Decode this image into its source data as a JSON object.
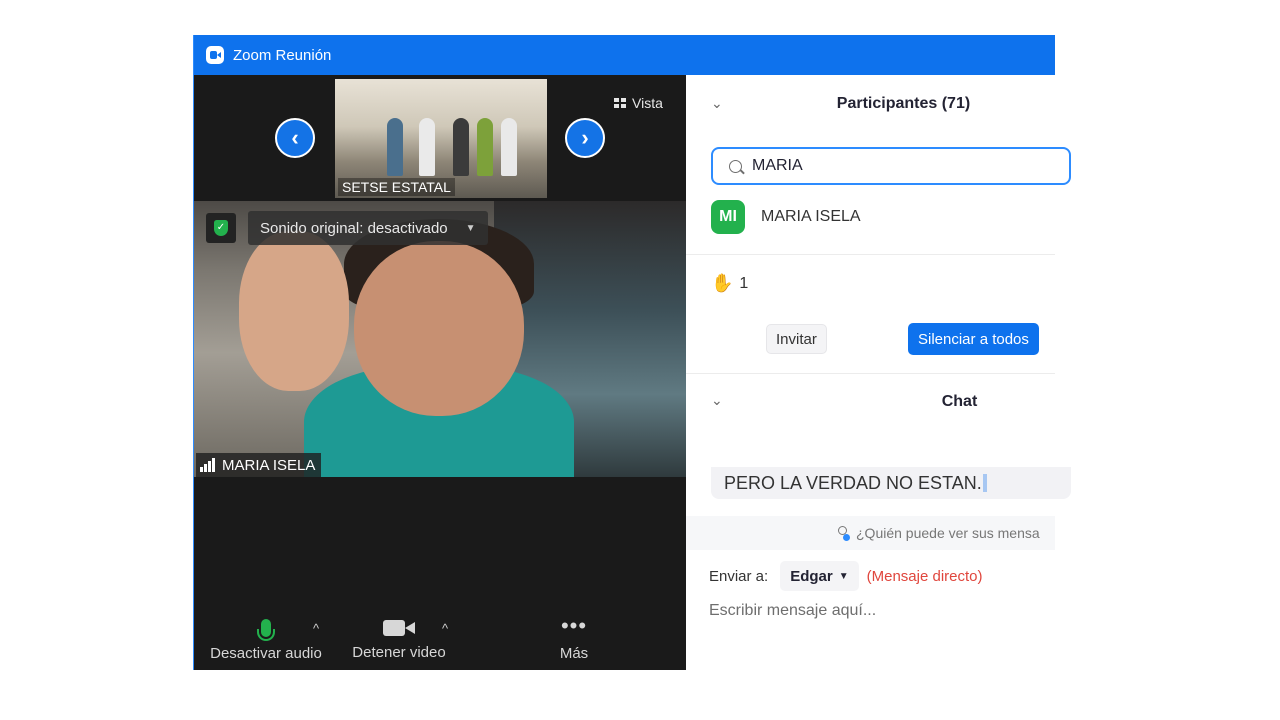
{
  "window": {
    "title": "Zoom Reunión"
  },
  "thumbnail": {
    "name": "SETSE ESTATAL"
  },
  "view_button": {
    "label": "Vista"
  },
  "main_video": {
    "sound_label": "Sonido original: desactivado",
    "participant_name": "MARIA ISELA"
  },
  "toolbar": {
    "audio_label": "Desactivar audio",
    "video_label": "Detener video",
    "more_label": "Más"
  },
  "participants": {
    "header": "Participantes (71)",
    "search_value": "MARIA",
    "results": [
      {
        "initials": "MI",
        "name": "MARIA ISELA"
      }
    ],
    "raised_hands": "1",
    "invite_label": "Invitar",
    "mute_all_label": "Silenciar a todos"
  },
  "chat": {
    "header": "Chat",
    "last_message": "PERO LA VERDAD NO ESTAN.",
    "who_can_see": "¿Quién puede ver sus mensa",
    "send_to_label": "Enviar a:",
    "recipient": "Edgar",
    "direct_label": "(Mensaje directo)",
    "compose_placeholder": "Escribir mensaje aquí..."
  },
  "colors": {
    "titlebar": "#0e72ed",
    "accent": "#2d8cff",
    "mic_active": "#23b14d",
    "direct_message": "#e0463d"
  }
}
